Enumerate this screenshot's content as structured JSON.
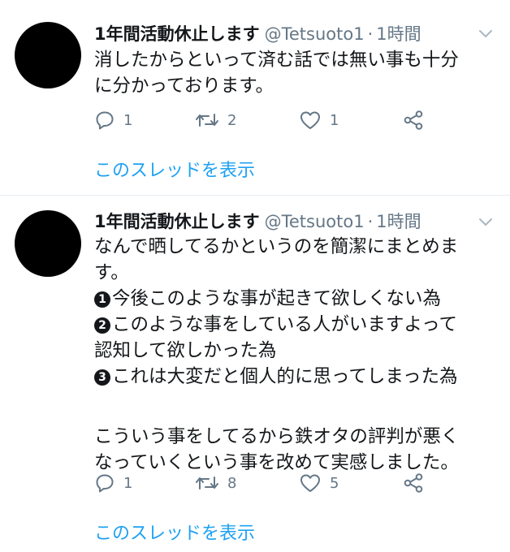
{
  "tweets": [
    {
      "display_name": "1年間活動休止します",
      "handle": "@Tetsuoto1",
      "separator": "·",
      "time": "1時間",
      "lines": [
        "消したからといって済む話では無い事も十分",
        "に分かっております。"
      ],
      "reply_count": "1",
      "retweet_count": "2",
      "like_count": "1",
      "thread_link": "このスレッドを表示"
    },
    {
      "display_name": "1年間活動休止します",
      "handle": "@Tetsuoto1",
      "separator": "·",
      "time": "1時間",
      "lines": [
        "なんで晒してるかというのを簡潔にまとめま",
        "す。"
      ],
      "numbered": [
        {
          "marker": "1",
          "text": "今後このような事が起きて欲しくない為"
        },
        {
          "marker": "2",
          "text": "このような事をしている人がいますよって"
        }
      ],
      "continuation": "認知して欲しかった為",
      "numbered_3": {
        "marker": "3",
        "text": "これは大変だと個人的に思ってしまった為"
      },
      "closing": [
        "こういう事をしてるから鉄オタの評判が悪く",
        "なっていくという事を改めて実感しました。"
      ],
      "reply_count": "1",
      "retweet_count": "8",
      "like_count": "5",
      "thread_link": "このスレッドを表示"
    }
  ],
  "icons": {
    "reply": "reply-icon",
    "retweet": "retweet-icon",
    "like": "heart-icon",
    "share": "share-icon",
    "caret": "chevron-down-icon"
  },
  "colors": {
    "text": "#14171a",
    "secondary": "#657786",
    "link": "#1da1f2",
    "divider": "#e6ecf0",
    "avatar": "#000000"
  }
}
